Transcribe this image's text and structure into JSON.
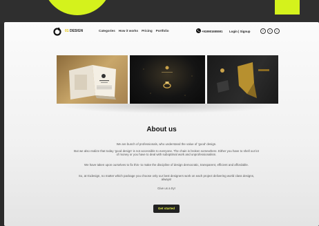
{
  "colors": {
    "accent": "#d4f21c",
    "background": "#2b2b2b",
    "button_bg": "#222222",
    "button_text": "#e6f04a"
  },
  "brand": {
    "logo_accent": "01",
    "logo_name": "DESIGN"
  },
  "nav": {
    "items": [
      "Categories",
      "How it works",
      "Pricing",
      "Portfolio"
    ],
    "phone": "+919901655591",
    "login": "Login | Signup",
    "social": [
      "f",
      "t",
      "i"
    ]
  },
  "gallery": {
    "icons": [
      "book-mockup-image",
      "ring-product-image",
      "gold-card-image"
    ]
  },
  "about": {
    "title": "About us",
    "paragraphs": [
      "We are bunch of professionals, who understand the value of 'good' design.",
      "But we also realize that today 'good design' is not accessible to everyone. The chain is broken somewhere. Either you have to shell out lot of money or you have to deal with suboptimal work and unprofessionalism.",
      "We have taken upon ourselves to fix this- to make the discipline of design democratic, transparent, efficient and affordable.",
      "So, at 01design, no matter which package you choose only our best designers work on each project delivering world class designs, always!",
      "Give us a try!"
    ],
    "cta": "Get started"
  }
}
